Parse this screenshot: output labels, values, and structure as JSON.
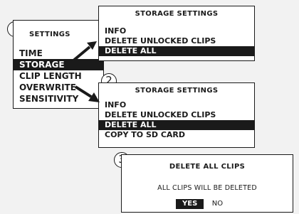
{
  "steps": [
    "1",
    "2",
    "3"
  ],
  "settings": {
    "title": "SETTINGS",
    "items": [
      {
        "label": "TIME"
      },
      {
        "label": "STORAGE"
      },
      {
        "label": "CLIP LENGTH"
      },
      {
        "label": "OVERWRITE"
      },
      {
        "label": "SENSITIVITY"
      }
    ],
    "selected_index": 1
  },
  "storage_menu_a": {
    "title": "STORAGE SETTINGS",
    "items": [
      {
        "label": "INFO"
      },
      {
        "label": "DELETE UNLOCKED CLIPS"
      },
      {
        "label": "DELETE ALL"
      }
    ],
    "selected_index": 2
  },
  "storage_menu_b": {
    "title": "STORAGE SETTINGS",
    "items": [
      {
        "label": "INFO"
      },
      {
        "label": "DELETE UNLOCKED CLIPS"
      },
      {
        "label": "DELETE ALL"
      },
      {
        "label": "COPY TO SD CARD"
      }
    ],
    "selected_index": 2
  },
  "delete_dialog": {
    "title": "DELETE ALL CLIPS",
    "message": "ALL CLIPS WILL BE DELETED",
    "yes_label": "YES",
    "no_label": "NO"
  },
  "colors": {
    "ink": "#1a1a1a",
    "paper": "#ffffff",
    "background": "#f2f2f2"
  }
}
